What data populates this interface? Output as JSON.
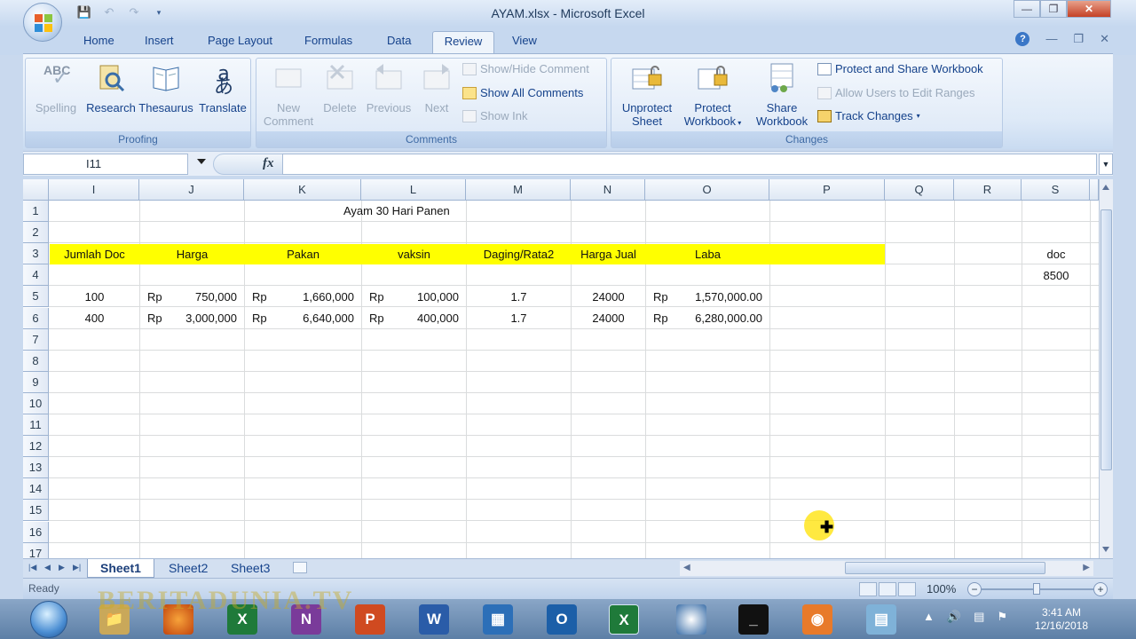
{
  "window": {
    "title": "AYAM.xlsx - Microsoft Excel"
  },
  "ribbon_tabs": [
    "Home",
    "Insert",
    "Page Layout",
    "Formulas",
    "Data",
    "Review",
    "View"
  ],
  "active_tab": "Review",
  "groups": {
    "proofing": {
      "label": "Proofing",
      "buttons": [
        "Spelling",
        "Research",
        "Thesaurus",
        "Translate"
      ],
      "abc": "ABC",
      "translate_glyph": "aあ"
    },
    "comments": {
      "label": "Comments",
      "big_buttons": [
        [
          "New",
          "Comment"
        ],
        [
          "Delete"
        ],
        [
          "Previous"
        ],
        [
          "Next"
        ]
      ],
      "small_buttons": [
        "Show/Hide Comment",
        "Show All Comments",
        "Show Ink"
      ]
    },
    "changes": {
      "label": "Changes",
      "big_buttons": [
        [
          "Unprotect",
          "Sheet"
        ],
        [
          "Protect",
          "Workbook"
        ],
        [
          "Share",
          "Workbook"
        ]
      ],
      "small_buttons": [
        "Protect and Share Workbook",
        "Allow Users to Edit Ranges",
        "Track Changes"
      ]
    }
  },
  "formula_bar": {
    "name_box": "I11",
    "fx": "fx",
    "formula": ""
  },
  "columns": [
    "I",
    "J",
    "K",
    "L",
    "M",
    "N",
    "O",
    "P",
    "Q",
    "R",
    "S"
  ],
  "rows": [
    "1",
    "2",
    "3",
    "4",
    "5",
    "6",
    "7",
    "8",
    "9",
    "10",
    "11",
    "12",
    "13",
    "14",
    "15",
    "16",
    "17"
  ],
  "sheet": {
    "title": "Ayam 30 Hari Panen",
    "headers": [
      "Jumlah Doc",
      "Harga",
      "Pakan",
      "vaksin",
      "Daging/Rata2",
      "Harga Jual",
      "Laba"
    ],
    "side_label": "doc",
    "side_value": "8500",
    "currency": "Rp",
    "data_rows": [
      {
        "doc": "100",
        "harga": "750,000",
        "pakan": "1,660,000",
        "vaksin": "100,000",
        "daging": "1.7",
        "harga_jual": "24000",
        "laba": "1,570,000.00"
      },
      {
        "doc": "400",
        "harga": "3,000,000",
        "pakan": "6,640,000",
        "vaksin": "400,000",
        "daging": "1.7",
        "harga_jual": "24000",
        "laba": "6,280,000.00"
      }
    ]
  },
  "sheet_tabs": [
    "Sheet1",
    "Sheet2",
    "Sheet3"
  ],
  "active_sheet": "Sheet1",
  "status": {
    "text": "Ready",
    "zoom": "100%"
  },
  "taskbar": {
    "apps": [
      "Firefox",
      "Excel",
      "OneNote",
      "PowerPoint",
      "Word",
      "Publisher",
      "Outlook",
      "Excel",
      "Media Player",
      "Command Prompt",
      "Recorder",
      "Explorer"
    ],
    "clock_time": "3:41 AM",
    "clock_date": "12/16/2018"
  },
  "watermark": "BERITADUNIA.TV",
  "colors": {
    "highlight": "#ffff00",
    "ribbon_text": "#15428b",
    "accent": "#3b77c7"
  }
}
